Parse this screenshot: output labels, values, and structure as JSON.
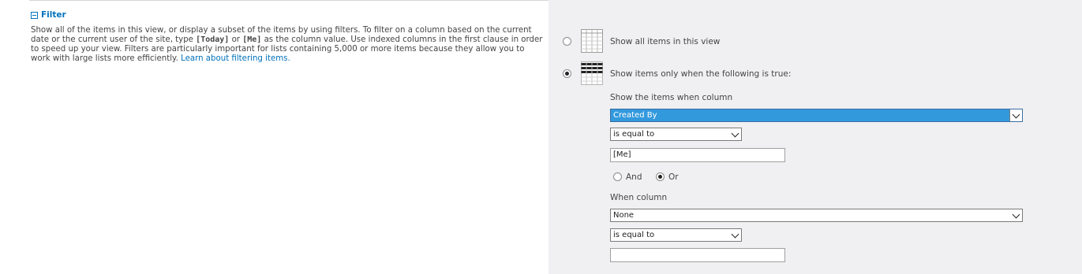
{
  "filter": {
    "title": "Filter",
    "description_parts": {
      "p1": "Show all of the items in this view, or display a subset of the items by using filters. To filter on a column based on the current date or the current user of the site, type ",
      "today": "[Today]",
      "p2": " or ",
      "me": "[Me]",
      "p3": " as the column value. Use indexed columns in the first clause in order to speed up your view. Filters are particularly important for lists containing 5,000 or more items because they allow you to work with large lists more efficiently. ",
      "link": "Learn about filtering items."
    },
    "options": {
      "show_all_label": "Show all items in this view",
      "show_filtered_label": "Show items only when the following is true:",
      "selected": "show_filtered"
    },
    "clause1": {
      "column_label": "Show the items when column",
      "column_value": "Created By",
      "operator_value": "is equal to",
      "value": "[Me]"
    },
    "join": {
      "and_label": "And",
      "or_label": "Or",
      "selected": "Or"
    },
    "clause2": {
      "column_label": "When column",
      "column_value": "None",
      "operator_value": "is equal to",
      "value": ""
    }
  },
  "colors": {
    "link": "#0072bc",
    "pane_background": "#f0f0f2",
    "selection": "#3399dd"
  },
  "icons": {
    "collapse": "collapse-minus-icon",
    "all_items": "grid-all-items-icon",
    "filtered_items": "grid-filtered-items-icon"
  }
}
